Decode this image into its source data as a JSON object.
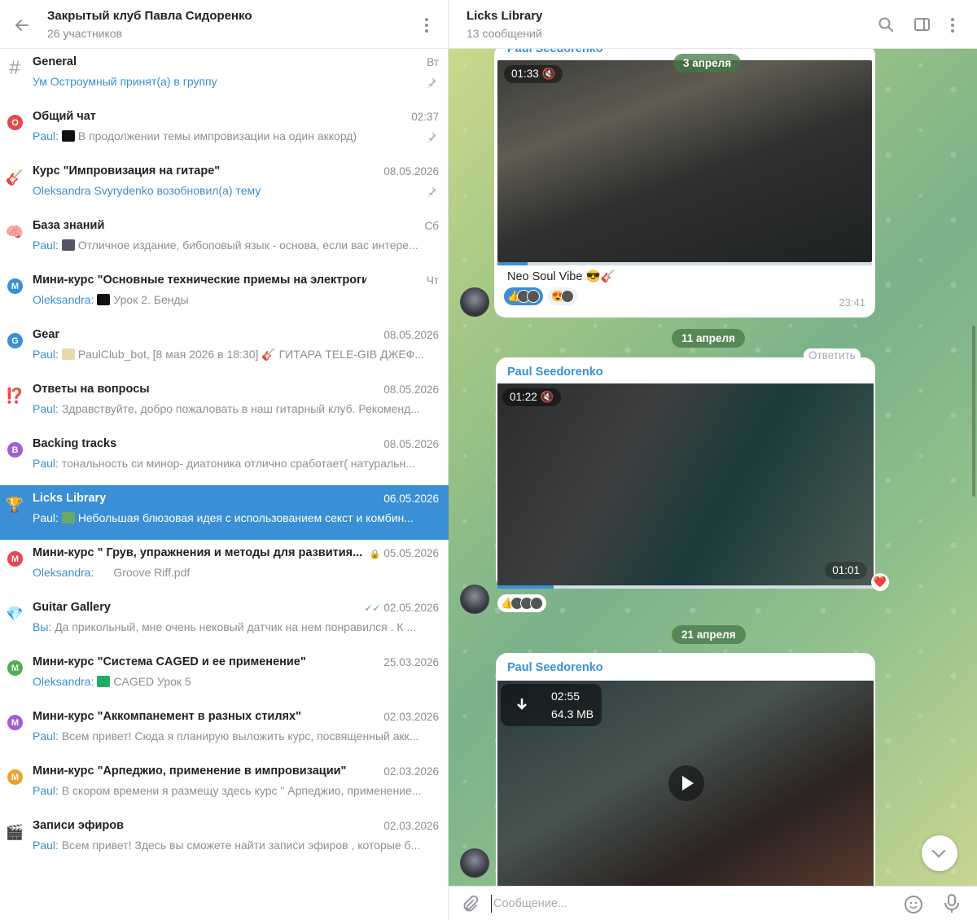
{
  "left_header": {
    "title": "Закрытый клуб Павла Сидоренко",
    "subtitle": "26 участников"
  },
  "topics": [
    {
      "icon": "#",
      "icon_type": "hash",
      "name": "General",
      "date": "Вт",
      "sender": "",
      "text": "",
      "system": "Ум Остроумный принят(а) в группу",
      "pinned": true
    },
    {
      "icon": "О",
      "icon_type": "circle",
      "color": "#e5484d",
      "name": "Общий чат",
      "date": "02:37",
      "sender": "Paul:",
      "text": "В продолжении темы импровизации на один аккорд)",
      "thumb": "#111",
      "pinned": true
    },
    {
      "icon": "🎸",
      "icon_type": "emoji",
      "name": "Курс \"Импровизация на гитаре\"",
      "date": "08.05.2026",
      "sender": "",
      "text": "",
      "system": "Oleksandra Svyrydenko возобновил(а) тему",
      "pinned": true
    },
    {
      "icon": "🧠",
      "icon_type": "emoji",
      "name": "База знаний",
      "date": "Сб",
      "sender": "Paul:",
      "text": "Отличное издание, бибоповый язык - основа, если вас интере...",
      "thumb": "#556"
    },
    {
      "icon": "М",
      "icon_type": "circle",
      "color": "#3a8fd6",
      "name": "Мини-курс \"Основные технические приемы на электрогитаре\"",
      "date": "Чт",
      "sender": "Oleksandra:",
      "text": "Урок 2. Бенды",
      "thumb": "#111"
    },
    {
      "icon": "G",
      "icon_type": "circle",
      "color": "#3a8fd6",
      "name": "Gear",
      "date": "08.05.2026",
      "sender": "Paul:",
      "text": "PaulClub_bot, [8 мая 2026 в 18:30] 🎸  ГИТАРА  TELE-GIB ДЖЕФ...",
      "thumb": "#e8d8b0"
    },
    {
      "icon": "⁉️",
      "icon_type": "emoji",
      "name": "Ответы на вопросы",
      "date": "08.05.2026",
      "sender": "Paul:",
      "text": "Здравствуйте, добро пожаловать в наш гитарный клуб. Рекоменд..."
    },
    {
      "icon": "B",
      "icon_type": "circle",
      "color": "#a35ed6",
      "name": "Backing tracks",
      "date": "08.05.2026",
      "sender": "Paul:",
      "text": "тональность си минор- диатоника отлично сработает( натуральн..."
    },
    {
      "icon": "🏆",
      "icon_type": "emoji",
      "name": "Licks Library",
      "date": "06.05.2026",
      "sender": "Paul:",
      "text": "Небольшая блюзовая идея с использованием секст и комбин...",
      "thumb": "#6a6",
      "active": true
    },
    {
      "icon": "М",
      "icon_type": "circle",
      "color": "#e5484d",
      "name": "Мини-курс \" Грув, упражнения и методы для развития...",
      "date": "05.05.2026",
      "sender": "Oleksandra:",
      "text": "Groove Riff.pdf",
      "locked": true,
      "thumb": "#fff"
    },
    {
      "icon": "💎",
      "icon_type": "emoji",
      "name": "Guitar Gallery",
      "date": "02.05.2026",
      "sender": "Вы:",
      "text": "Да прикольный, мне очень нековый датчик на нем понравился . К ...",
      "read": true
    },
    {
      "icon": "М",
      "icon_type": "circle",
      "color": "#4fae4e",
      "name": "Мини-курс \"Система CAGED и ее применение\"",
      "date": "25.03.2026",
      "sender": "Oleksandra:",
      "text": "CAGED Урок 5",
      "thumb": "#2a6"
    },
    {
      "icon": "М",
      "icon_type": "circle",
      "color": "#a35ed6",
      "name": "Мини-курс \"Аккомпанемент в разных стилях\"",
      "date": "02.03.2026",
      "sender": "Paul:",
      "text": "Всем привет! Сюда я планирую выложить курс, посвященный акк..."
    },
    {
      "icon": "М",
      "icon_type": "circle",
      "color": "#f0a030",
      "name": "Мини-курс \"Арпеджио, применение в импровизации\"",
      "date": "02.03.2026",
      "sender": "Paul:",
      "text": "В скором времени я размещу здесь курс \" Арпеджио, применение..."
    },
    {
      "icon": "🎬",
      "icon_type": "emoji",
      "name": "Записи эфиров",
      "date": "02.03.2026",
      "sender": "Paul:",
      "text": "Всем привет! Здесь вы сможете найти записи эфиров , которые б..."
    }
  ],
  "right_header": {
    "title": "Licks Library",
    "subtitle": "13 сообщений"
  },
  "messages": {
    "m1": {
      "sender": "Paul Seedorenko",
      "video_time": "01:33",
      "caption": "Neo Soul Vibe 😎🎸",
      "time": "23:41",
      "date_chip": "3 апреля",
      "progress": 0.08,
      "reactions": [
        "👍",
        "😍"
      ]
    },
    "date2": "11 апреля",
    "m2": {
      "sender": "Paul Seedorenko",
      "reply_label": "Ответить",
      "video_time": "01:22",
      "remaining": "01:01",
      "progress": 0.15,
      "reaction": "👍",
      "heart": "❤️"
    },
    "date3": "21 апреля",
    "m3": {
      "sender": "Paul Seedorenko",
      "duration": "02:55",
      "size": "64.3 MB"
    }
  },
  "composer": {
    "placeholder": "Сообщение..."
  },
  "colors": {
    "accent": "#3a8fd6",
    "active_row": "#3a8fd6"
  }
}
